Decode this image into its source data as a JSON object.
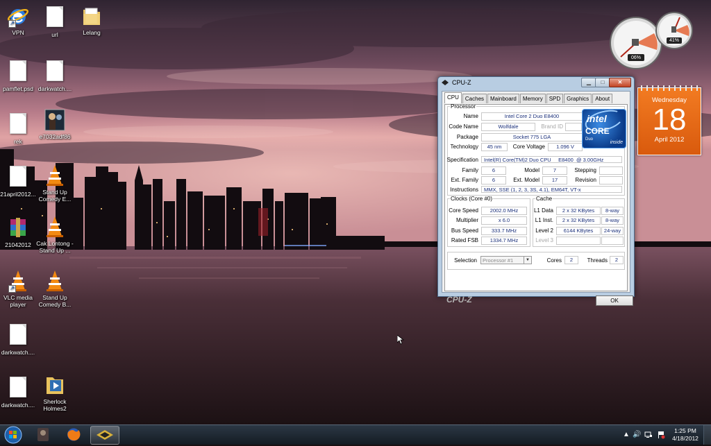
{
  "desktop": {
    "icons": [
      {
        "label": "VPN"
      },
      {
        "label": "url"
      },
      {
        "label": "Lelang"
      },
      {
        "label": "pamflet.psd"
      },
      {
        "label": "darkwatch...."
      },
      {
        "label": "rek"
      },
      {
        "label": "e7032adf86"
      },
      {
        "label": "21april2012..."
      },
      {
        "label": "Stand Up Comedy E..."
      },
      {
        "label": "21042012"
      },
      {
        "label": "Cak Lontong - Stand Up ..."
      },
      {
        "label": "VLC media player"
      },
      {
        "label": "Stand Up Comedy B..."
      },
      {
        "label": "darkwatch...."
      },
      {
        "label": "darkwatch...."
      },
      {
        "label": "Sherlock Holmes2"
      }
    ]
  },
  "gadgets": {
    "cpu_meter": {
      "cpu_percent": "06%",
      "memory_percent": "41%"
    },
    "calendar": {
      "weekday": "Wednesday",
      "day": "18",
      "month_year": "April 2012",
      "color": "#e8671a"
    }
  },
  "cpuz": {
    "title": "CPU-Z",
    "tabs": [
      "CPU",
      "Caches",
      "Mainboard",
      "Memory",
      "SPD",
      "Graphics",
      "About"
    ],
    "active_tab": "CPU",
    "processor": {
      "legend": "Processor",
      "name_label": "Name",
      "name": "Intel Core 2 Duo E8400",
      "codename_label": "Code Name",
      "codename": "Wolfdale",
      "brandid_label": "Brand ID",
      "package_label": "Package",
      "package": "Socket 775 LGA",
      "technology_label": "Technology",
      "technology": "45 nm",
      "corevoltage_label": "Core Voltage",
      "corevoltage": "1.096 V",
      "specification_label": "Specification",
      "specification": "Intel(R) Core(TM)2 Duo CPU     E8400  @ 3.00GHz",
      "family_label": "Family",
      "family": "6",
      "model_label": "Model",
      "model": "7",
      "stepping_label": "Stepping",
      "extfamily_label": "Ext. Family",
      "extfamily": "6",
      "extmodel_label": "Ext. Model",
      "extmodel": "17",
      "revision_label": "Revision",
      "instructions_label": "Instructions",
      "instructions": "MMX, SSE (1, 2, 3, 3S, 4.1), EM64T, VT-x"
    },
    "intel_logo": {
      "brand": "intel",
      "line": "CORE",
      "sub": "Duo",
      "tagline": "inside"
    },
    "clocks": {
      "legend": "Clocks (Core #0)",
      "corespeed_label": "Core Speed",
      "corespeed": "2002.0 MHz",
      "multiplier_label": "Multiplier",
      "multiplier": "x 6.0",
      "busspeed_label": "Bus Speed",
      "busspeed": "333.7 MHz",
      "ratedfsb_label": "Rated FSB",
      "ratedfsb": "1334.7 MHz"
    },
    "cache": {
      "legend": "Cache",
      "l1data_label": "L1 Data",
      "l1data": "2 x 32 KBytes",
      "l1data_way": "8-way",
      "l1inst_label": "L1 Inst.",
      "l1inst": "2 x 32 KBytes",
      "l1inst_way": "8-way",
      "level2_label": "Level 2",
      "level2": "6144 KBytes",
      "level2_way": "24-way",
      "level3_label": "Level 3"
    },
    "selection_label": "Selection",
    "selection_value": "Processor #1",
    "cores_label": "Cores",
    "cores": "2",
    "threads_label": "Threads",
    "threads": "2",
    "brand": "CPU-Z",
    "ok_label": "OK"
  },
  "taskbar": {
    "clock_time": "1:25 PM",
    "clock_date": "4/18/2012"
  }
}
